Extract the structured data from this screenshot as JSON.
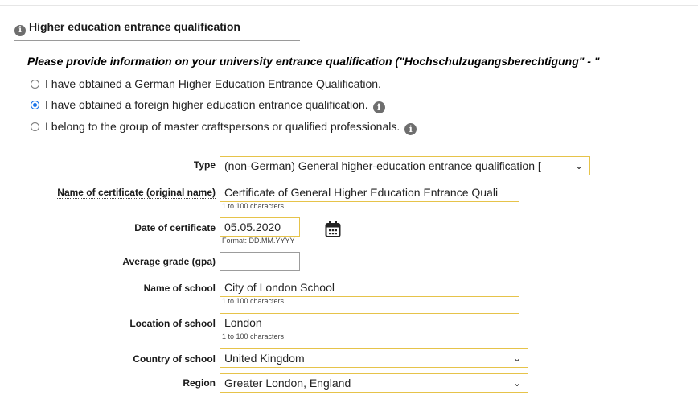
{
  "section": {
    "title": "Higher education entrance qualification",
    "icon": "info-icon"
  },
  "intro": "Please provide information on your university entrance qualification (\"Hochschulzugangsberechtigung\" - \"",
  "options": [
    {
      "label": "I have obtained a German Higher Education Entrance Qualification.",
      "selected": false,
      "info": false
    },
    {
      "label": "I have obtained a foreign higher education entrance qualification.",
      "selected": true,
      "info": true
    },
    {
      "label": "I belong to the group of master craftspersons or qualified professionals.",
      "selected": false,
      "info": true
    }
  ],
  "form": {
    "type": {
      "label": "Type",
      "value": "(non-German) General higher-education entrance qualification ["
    },
    "certificate_name": {
      "label": "Name of certificate (original name)",
      "value": "Certificate of General Higher Education Entrance Quali",
      "hint": "1 to 100 characters"
    },
    "certificate_date": {
      "label": "Date of certificate",
      "value": "05.05.2020",
      "hint": "Format: DD.MM.YYYY"
    },
    "average_grade": {
      "label": "Average grade (gpa)",
      "value": ""
    },
    "school_name": {
      "label": "Name of school",
      "value": "City of London School",
      "hint": "1 to 100 characters"
    },
    "school_location": {
      "label": "Location of school",
      "value": "London",
      "hint": "1 to 100 characters"
    },
    "school_country": {
      "label": "Country of school",
      "value": "United Kingdom"
    },
    "region": {
      "label": "Region",
      "value": "Greater London, England"
    }
  },
  "colors": {
    "required_border": "#e6c34a",
    "radio_selected": "#1a73e8",
    "info_icon": "#6e6e6e"
  }
}
